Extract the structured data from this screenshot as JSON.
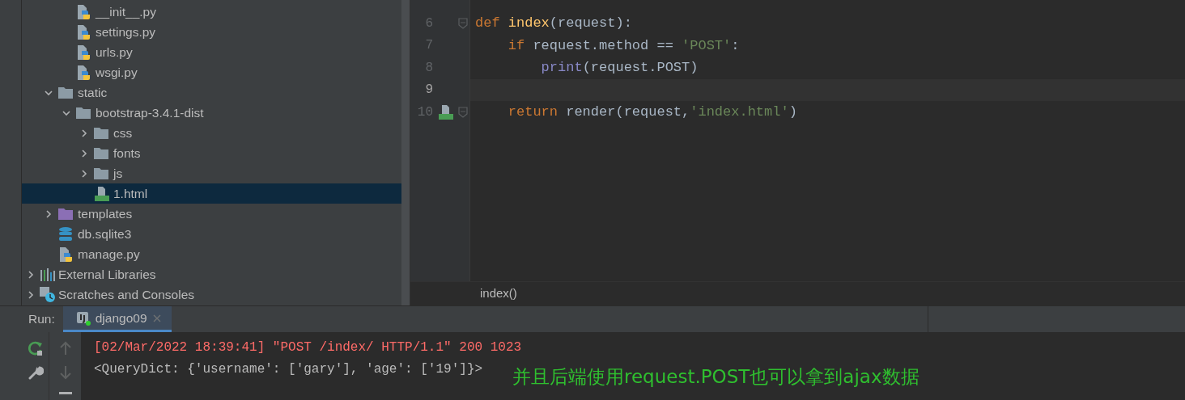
{
  "project_tree": {
    "items": [
      {
        "children": [
          {
            "children": [
              {
                "label": "__init__.py",
                "kind": "python",
                "selected": false
              },
              {
                "label": "settings.py",
                "kind": "python",
                "selected": false
              },
              {
                "label": "urls.py",
                "kind": "python",
                "selected": false
              },
              {
                "label": "wsgi.py",
                "kind": "python",
                "selected": false
              }
            ]
          },
          {
            "label": "static",
            "kind": "folder",
            "color": "#8c9ba5",
            "expanded": true,
            "selected": false,
            "children": [
              {
                "label": "bootstrap-3.4.1-dist",
                "kind": "folder",
                "color": "#8c9ba5",
                "expanded": true,
                "selected": false,
                "children": [
                  {
                    "label": "css",
                    "kind": "folder",
                    "color": "#8c9ba5",
                    "expanded": false,
                    "selected": false
                  },
                  {
                    "label": "fonts",
                    "kind": "folder",
                    "color": "#8c9ba5",
                    "expanded": false,
                    "selected": false
                  },
                  {
                    "label": "js",
                    "kind": "folder",
                    "color": "#8c9ba5",
                    "expanded": false,
                    "selected": false
                  },
                  {
                    "label": "1.html",
                    "kind": "html",
                    "selected": true
                  }
                ]
              }
            ]
          },
          {
            "label": "templates",
            "kind": "folder",
            "color": "#8b6fb5",
            "expanded": false,
            "selected": false
          },
          {
            "label": "db.sqlite3",
            "kind": "database",
            "selected": false
          },
          {
            "label": "manage.py",
            "kind": "python",
            "selected": false
          }
        ]
      },
      {
        "label": "External Libraries",
        "kind": "library",
        "expanded": false,
        "selected": false
      },
      {
        "label": "Scratches and Consoles",
        "kind": "scratches",
        "expanded": false,
        "selected": false
      }
    ]
  },
  "editor": {
    "lines": [
      {
        "number": "6",
        "current": false,
        "fold": true,
        "gutter_icon": false,
        "tokens": [
          {
            "kind": "keyword",
            "text": "def "
          },
          {
            "kind": "function",
            "text": "index"
          },
          {
            "kind": "plain",
            "text": "(request):"
          }
        ]
      },
      {
        "number": "7",
        "current": false,
        "fold": false,
        "gutter_icon": false,
        "tokens": [
          {
            "kind": "keyword",
            "text": "    if "
          },
          {
            "kind": "plain",
            "text": "request.method == "
          },
          {
            "kind": "string",
            "text": "'POST'"
          },
          {
            "kind": "plain",
            "text": ":"
          }
        ]
      },
      {
        "number": "8",
        "current": false,
        "fold": false,
        "gutter_icon": false,
        "tokens": [
          {
            "kind": "builtin",
            "text": "        print"
          },
          {
            "kind": "plain",
            "text": "(request.POST)"
          }
        ]
      },
      {
        "number": "9",
        "current": true,
        "fold": false,
        "gutter_icon": false
      },
      {
        "number": "10",
        "current": false,
        "fold": true,
        "gutter_icon": true,
        "tokens": [
          {
            "kind": "keyword",
            "text": "    return "
          },
          {
            "kind": "plain",
            "text": "render(request,"
          },
          {
            "kind": "string",
            "text": "'index.html'"
          },
          {
            "kind": "plain",
            "text": ")"
          }
        ]
      }
    ],
    "breadcrumb": "index()"
  },
  "run_panel": {
    "label": "Run:",
    "tabs": [
      {
        "label": "django09",
        "selected": true
      }
    ],
    "output": [
      {
        "kind": "error",
        "text": "[02/Mar/2022 18:39:41] \"POST /index/ HTTP/1.1\" 200 1023"
      },
      {
        "kind": "normal",
        "text": "<QueryDict: {'username': ['gary'], 'age': ['19']}>"
      }
    ]
  },
  "annotation": "并且后端使用request.POST也可以拿到ajax数据"
}
